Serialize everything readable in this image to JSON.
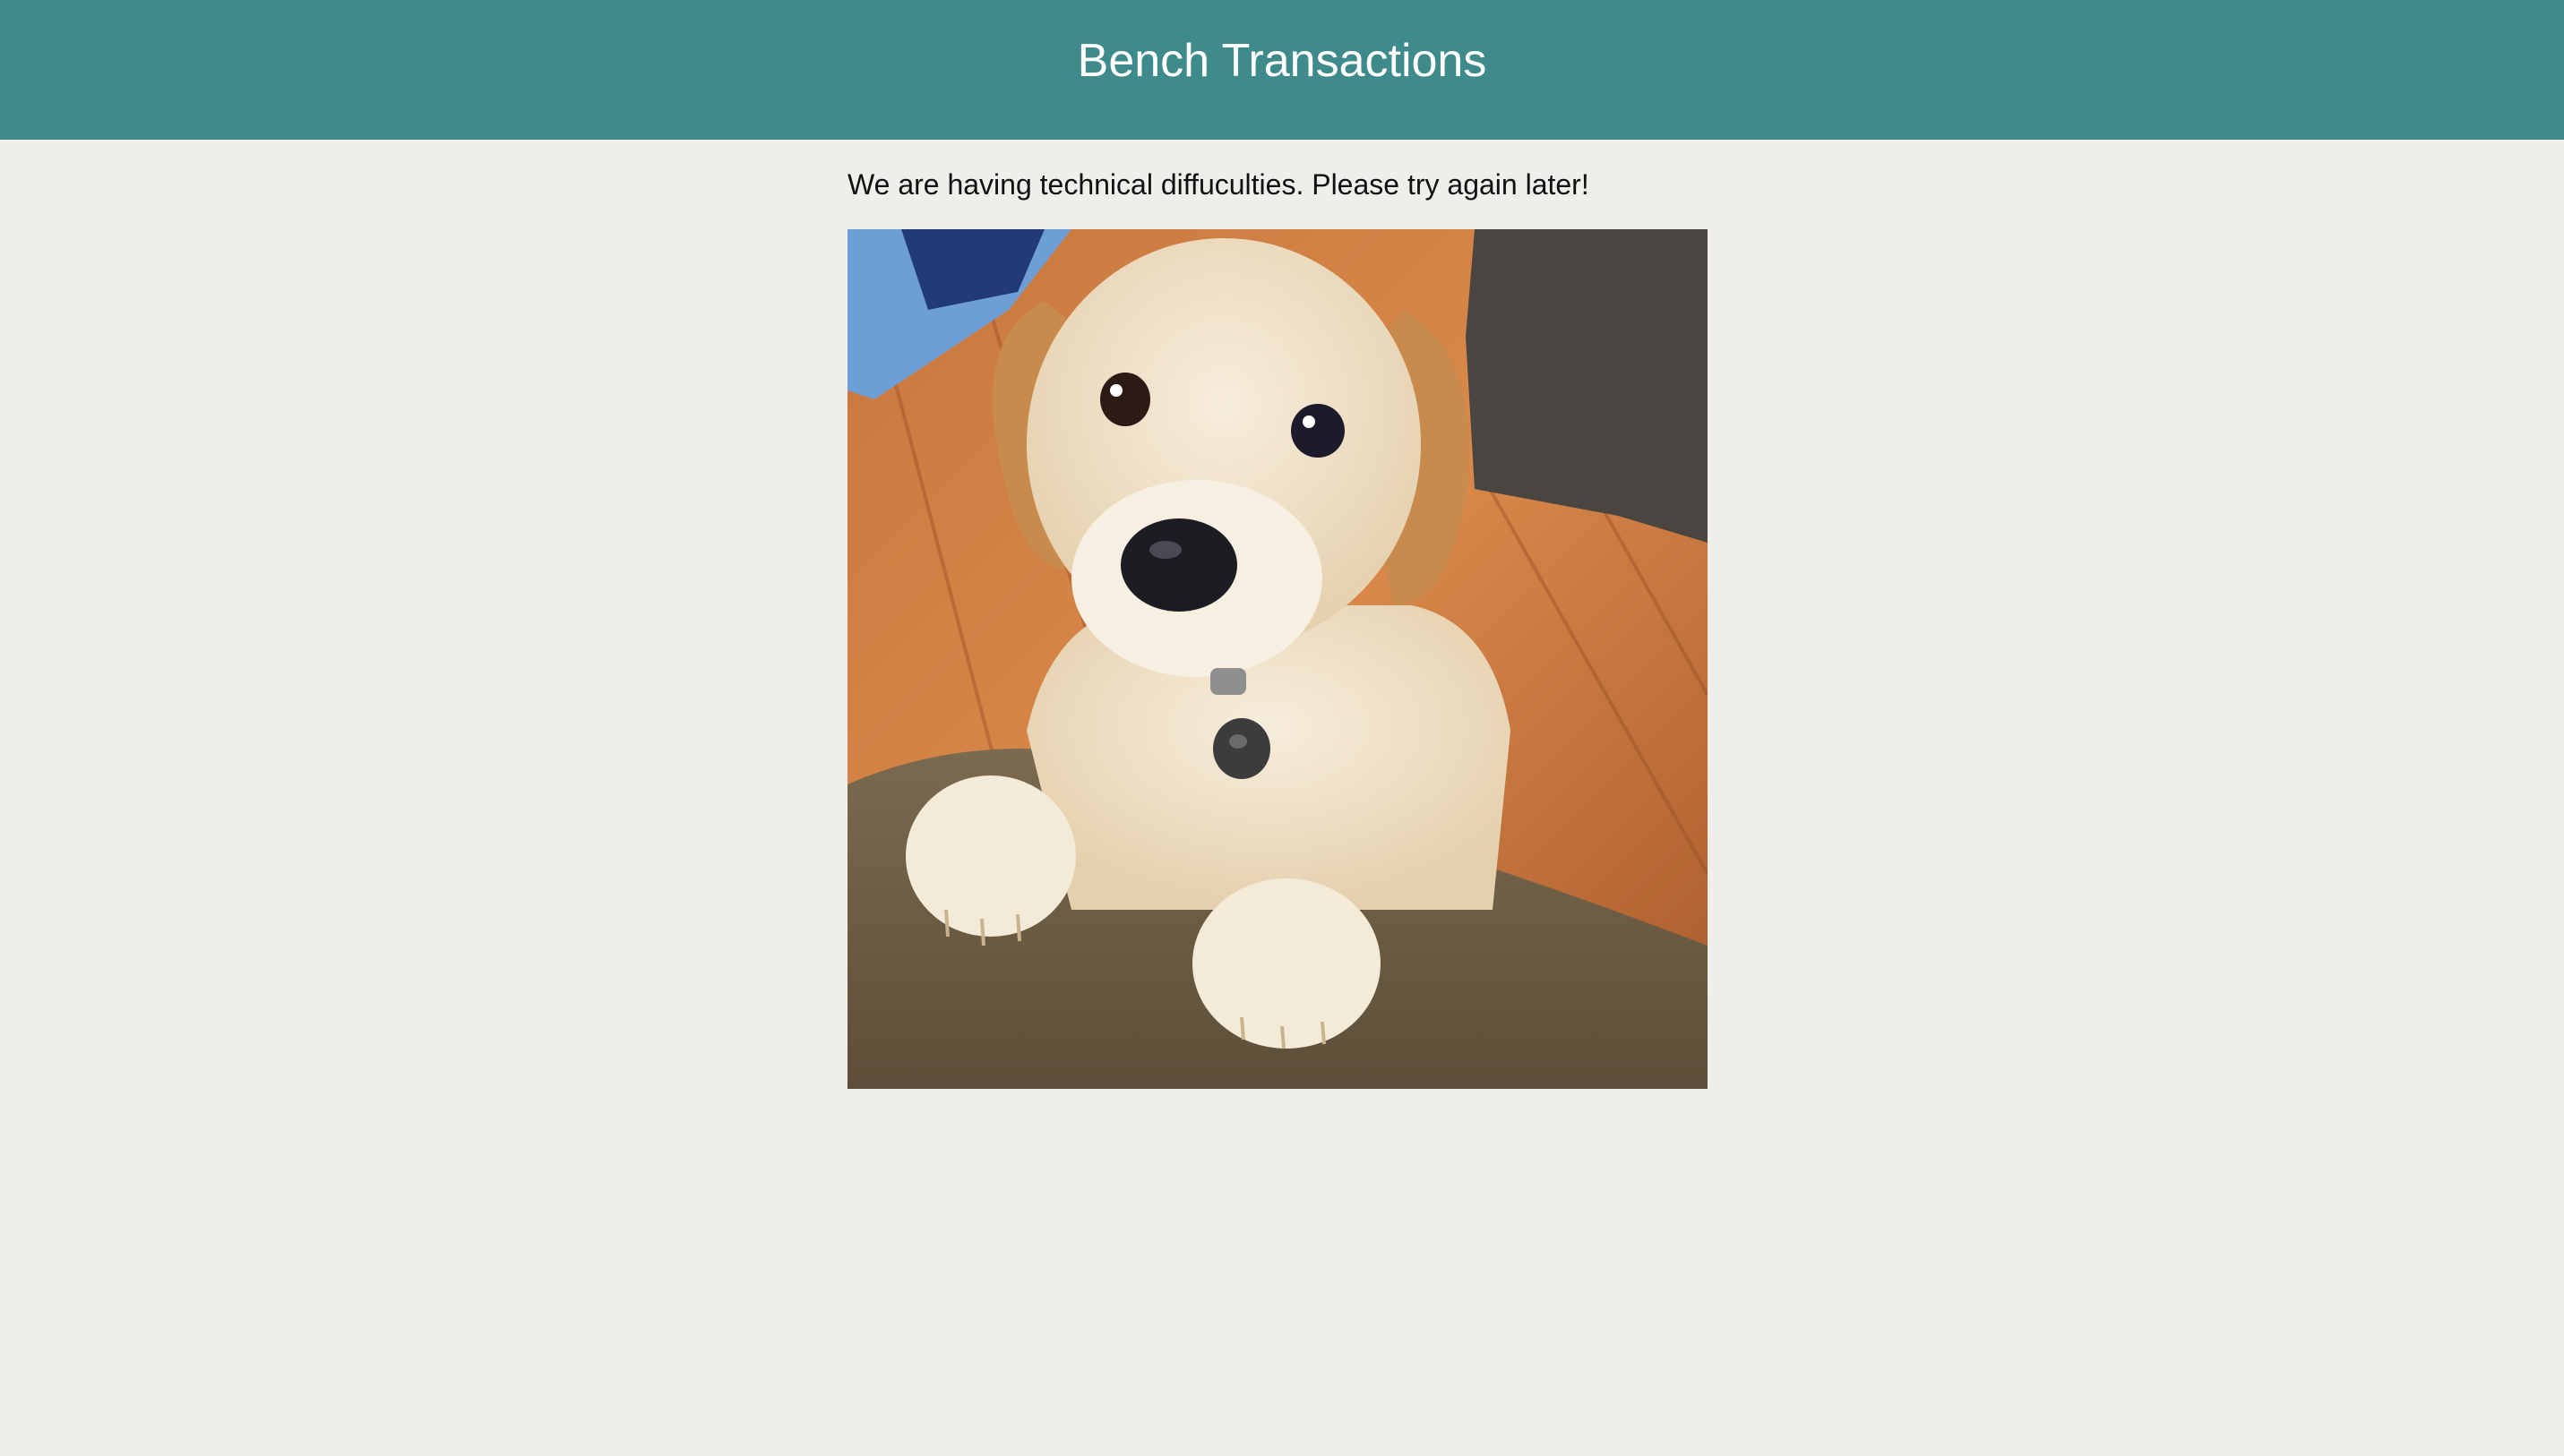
{
  "header": {
    "title": "Bench Transactions",
    "background_color": "#3f8a8b",
    "text_color": "#ffffff"
  },
  "main": {
    "message": "We are having technical diffuculties. Please try again later!",
    "image": {
      "icon": "puppy-photo"
    }
  },
  "colors": {
    "page_background": "#efeeea"
  }
}
